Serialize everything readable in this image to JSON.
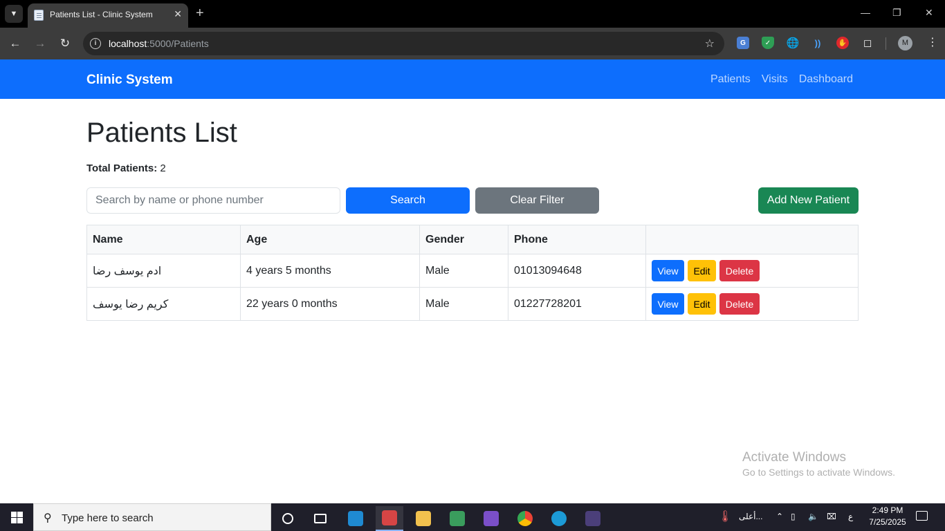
{
  "browser": {
    "tab_title": "Patients List - Clinic System",
    "url_host": "localhost",
    "url_path": ":5000/Patients",
    "profile_initial": "M"
  },
  "navbar": {
    "brand": "Clinic System",
    "links": [
      "Patients",
      "Visits",
      "Dashboard"
    ],
    "color": "#0d6efd"
  },
  "page": {
    "title": "Patients List",
    "total_label": "Total Patients:",
    "total_value": "2"
  },
  "search": {
    "placeholder": "Search by name or phone number",
    "value": ""
  },
  "buttons": {
    "search": "Search",
    "clear": "Clear Filter",
    "add": "Add New Patient"
  },
  "table": {
    "headers": [
      "Name",
      "Age",
      "Gender",
      "Phone",
      ""
    ],
    "rows": [
      {
        "name": "ادم يوسف رضا",
        "age": "4 years 5 months",
        "gender": "Male",
        "phone": "01013094648"
      },
      {
        "name": "كريم رضا يوسف",
        "age": "22 years 0 months",
        "gender": "Male",
        "phone": "01227728201"
      }
    ],
    "actions": {
      "view": "View",
      "edit": "Edit",
      "delete": "Delete"
    }
  },
  "watermark": {
    "title": "Activate Windows",
    "subtitle": "Go to Settings to activate Windows."
  },
  "taskbar": {
    "search_placeholder": "Type here to search",
    "weather_text": "أعلى...",
    "lang": "ع",
    "time": "2:49 PM",
    "date": "7/25/2025"
  },
  "icons": {
    "start": "windows-logo-icon",
    "search": "magnifier-icon",
    "star": "star-icon",
    "site_info": "info-icon"
  }
}
